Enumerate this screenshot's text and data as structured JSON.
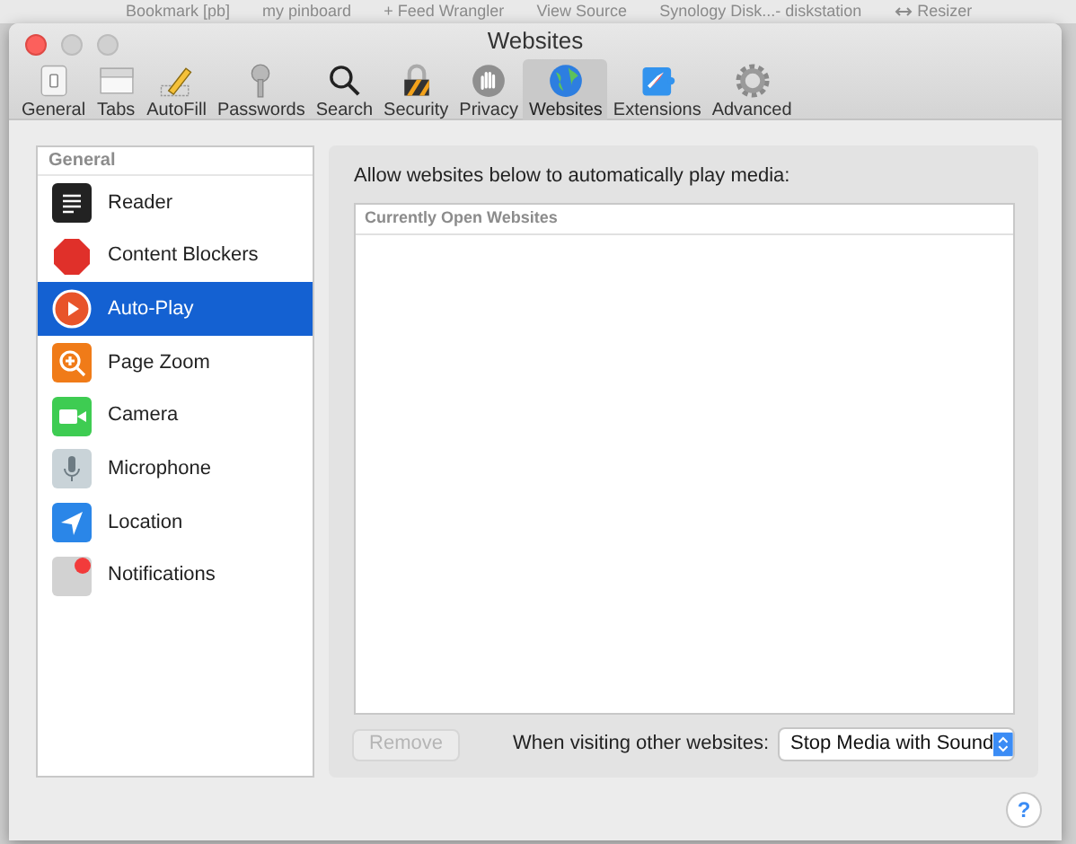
{
  "bookmarks": [
    {
      "label": "Bookmark [pb]"
    },
    {
      "label": "my pinboard"
    },
    {
      "label": "+ Feed Wrangler"
    },
    {
      "label": "View Source"
    },
    {
      "label": "Synology Disk...- diskstation"
    },
    {
      "label": "Resizer",
      "kind": "resize"
    }
  ],
  "window": {
    "title": "Websites"
  },
  "toolbar": [
    {
      "label": "General",
      "kind": "switch",
      "selected": false
    },
    {
      "label": "Tabs",
      "kind": "tabs",
      "selected": false
    },
    {
      "label": "AutoFill",
      "kind": "pencil",
      "selected": false
    },
    {
      "label": "Passwords",
      "kind": "key",
      "selected": false
    },
    {
      "label": "Search",
      "kind": "search",
      "selected": false
    },
    {
      "label": "Security",
      "kind": "lock",
      "selected": false
    },
    {
      "label": "Privacy",
      "kind": "hand",
      "selected": false
    },
    {
      "label": "Websites",
      "kind": "globe",
      "selected": true
    },
    {
      "label": "Extensions",
      "kind": "puzzle",
      "selected": false
    },
    {
      "label": "Advanced",
      "kind": "gear",
      "selected": false
    }
  ],
  "sidebar": {
    "heading": "General",
    "items": [
      {
        "label": "Reader",
        "kind": "reader",
        "selected": false
      },
      {
        "label": "Content Blockers",
        "kind": "stop",
        "selected": false
      },
      {
        "label": "Auto-Play",
        "kind": "play",
        "selected": true
      },
      {
        "label": "Page Zoom",
        "kind": "zoom",
        "selected": false
      },
      {
        "label": "Camera",
        "kind": "camera",
        "selected": false
      },
      {
        "label": "Microphone",
        "kind": "mic",
        "selected": false
      },
      {
        "label": "Location",
        "kind": "location",
        "selected": false
      },
      {
        "label": "Notifications",
        "kind": "notify",
        "selected": false
      }
    ]
  },
  "panel": {
    "description": "Allow websites below to automatically play media:",
    "table": {
      "column_1": "Currently Open Websites"
    },
    "remove_button": {
      "label": "Remove",
      "disabled": true
    },
    "other_label": "When visiting other websites:",
    "other_select": {
      "value": "Stop Media with Sound"
    }
  },
  "help_button": {
    "label": "?"
  }
}
